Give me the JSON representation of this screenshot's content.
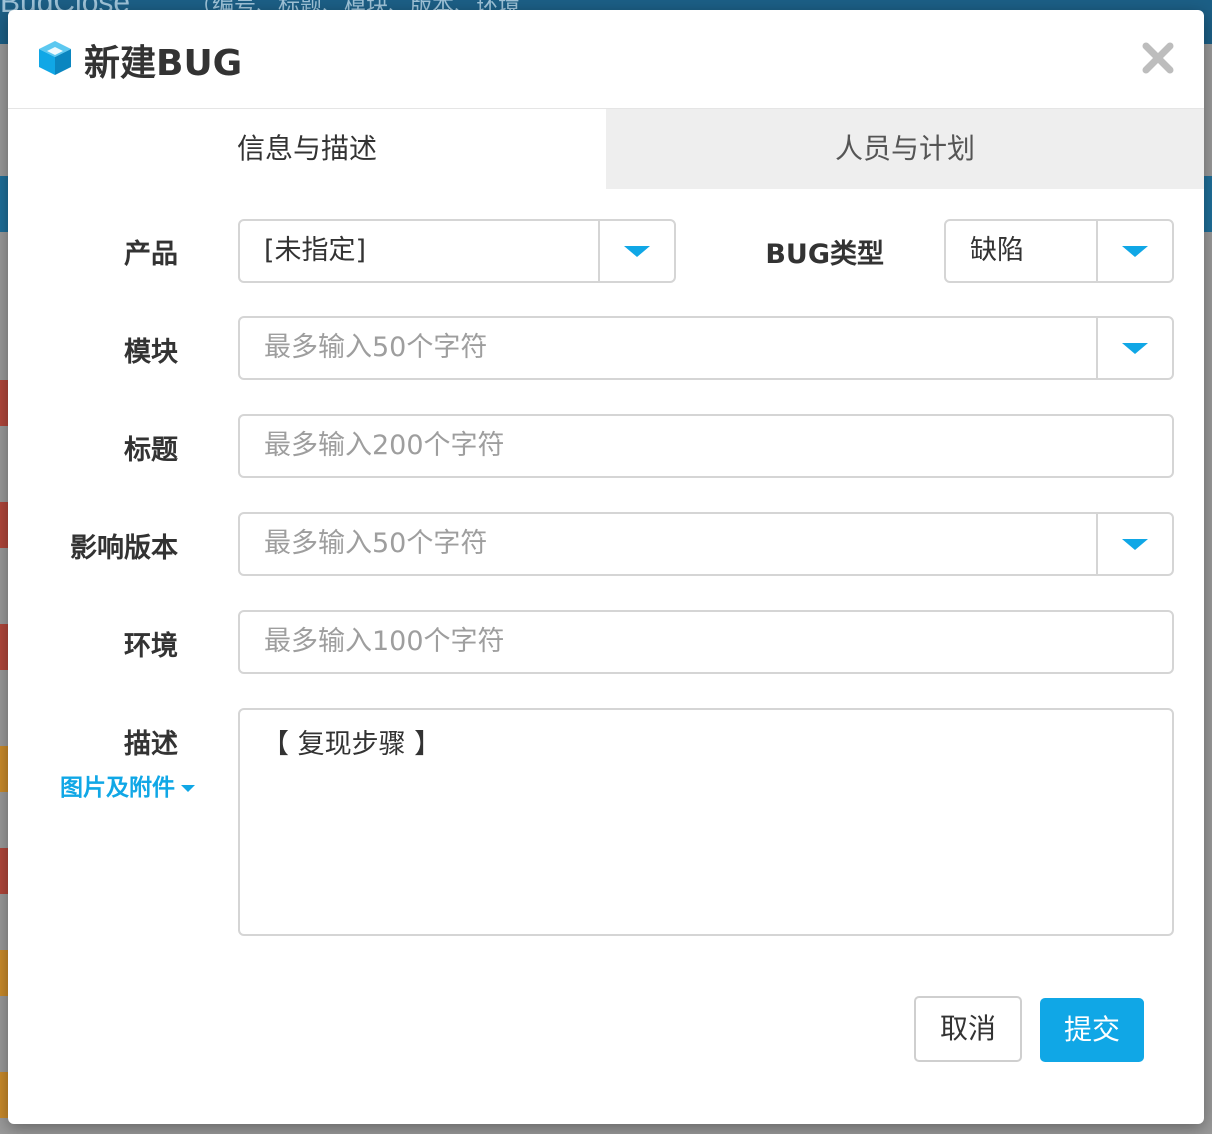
{
  "background": {
    "brand": "BugClose",
    "search_hint": "（编号、标题、模块、版本、环境"
  },
  "dialog": {
    "title": "新建BUG",
    "close_icon": "close-icon",
    "title_icon": "cube-icon"
  },
  "tabs": [
    {
      "label": "信息与描述",
      "active": true
    },
    {
      "label": "人员与计划",
      "active": false
    }
  ],
  "form": {
    "product": {
      "label": "产品",
      "value": "[未指定]"
    },
    "bug_type": {
      "label": "BUG类型",
      "value": "缺陷"
    },
    "module": {
      "label": "模块",
      "placeholder": "最多输入50个字符"
    },
    "title": {
      "label": "标题",
      "placeholder": "最多输入200个字符"
    },
    "affected_version": {
      "label": "影响版本",
      "placeholder": "最多输入50个字符"
    },
    "environment": {
      "label": "环境",
      "placeholder": "最多输入100个字符"
    },
    "description": {
      "label": "描述",
      "value": "【 复现步骤 】",
      "attachment_link": "图片及附件"
    }
  },
  "buttons": {
    "cancel": "取消",
    "submit": "提交"
  },
  "colors": {
    "accent": "#10a7e6",
    "tab_inactive_bg": "#eeeeee",
    "border": "#d5d5d5"
  }
}
